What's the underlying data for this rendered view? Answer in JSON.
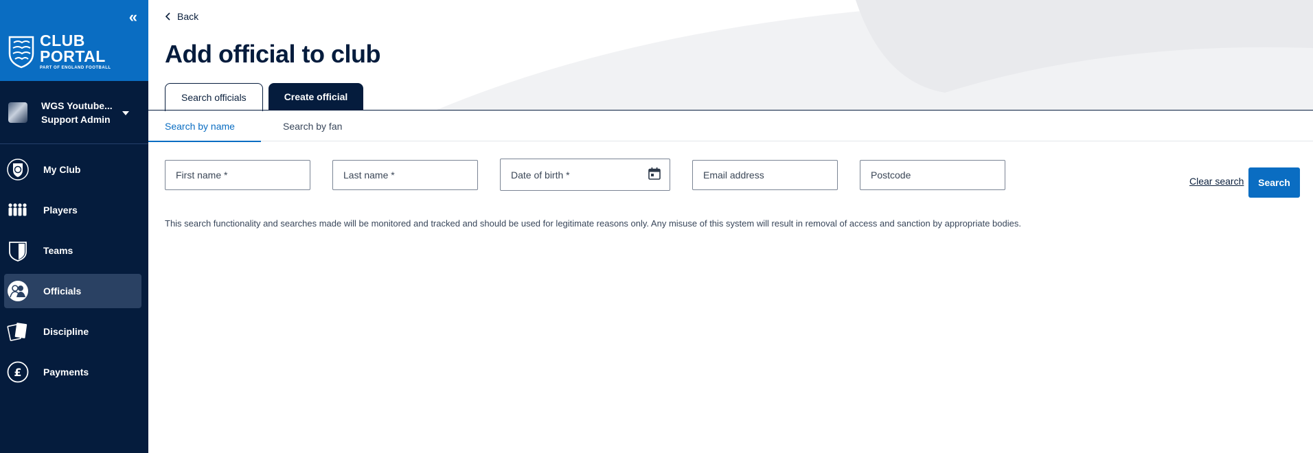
{
  "brand": {
    "line1": "CLUB",
    "line2": "PORTAL",
    "tagline": "PART OF ENGLAND FOOTBALL",
    "collapse_glyph": "«",
    "color": "#0a6dc2"
  },
  "club": {
    "name": "WGS Youtube...",
    "role": "Support Admin"
  },
  "nav": {
    "items": [
      {
        "label": "My Club",
        "icon": "shield-ball-icon"
      },
      {
        "label": "Players",
        "icon": "players-icon"
      },
      {
        "label": "Teams",
        "icon": "team-shield-icon"
      },
      {
        "label": "Officials",
        "icon": "officials-icon",
        "active": true
      },
      {
        "label": "Discipline",
        "icon": "cards-icon"
      },
      {
        "label": "Payments",
        "icon": "pound-icon"
      }
    ]
  },
  "header": {
    "back_label": "Back",
    "title": "Add official to club"
  },
  "tabs": {
    "search_officials": "Search officials",
    "create_official": "Create official",
    "active": "search_officials"
  },
  "subtabs": {
    "by_name": "Search by name",
    "by_fan": "Search by fan",
    "active": "by_name"
  },
  "form": {
    "first_name": {
      "placeholder": "First name *",
      "value": ""
    },
    "last_name": {
      "placeholder": "Last name *",
      "value": ""
    },
    "dob": {
      "placeholder": "Date of birth *",
      "value": ""
    },
    "email": {
      "placeholder": "Email address",
      "value": ""
    },
    "postcode": {
      "placeholder": "Postcode",
      "value": ""
    },
    "clear_label": "Clear search",
    "search_label": "Search"
  },
  "disclaimer": "This search functionality and searches made will be monitored and tracked and should be used for legitimate reasons only. Any misuse of this system will result in removal of access and sanction by appropriate bodies.",
  "colors": {
    "sidebar": "#051c3d",
    "accent": "#0a6dc2",
    "nav_active": "#2a4163"
  }
}
